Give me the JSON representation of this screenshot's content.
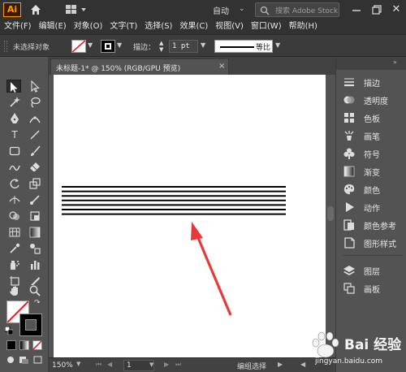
{
  "app": {
    "logo": "Ai",
    "workspace": "自动",
    "search_placeholder": "搜索 Adobe Stock"
  },
  "menu": [
    "文件(F)",
    "编辑(E)",
    "对象(O)",
    "文字(T)",
    "选择(S)",
    "效果(C)",
    "视图(V)",
    "窗口(W)",
    "帮助(H)"
  ],
  "control_bar": {
    "selection_status": "未选择对象",
    "stroke_label": "描边：",
    "stroke_weight": "1 pt",
    "profile_label": "等比"
  },
  "document": {
    "tab_title": "未标题-1* @ 150% (RGB/GPU 预览)",
    "close_glyph": "×"
  },
  "status_bar": {
    "zoom": "150%",
    "artboard_number": "1",
    "status_text": "编组选择"
  },
  "panels": [
    {
      "label": "描边",
      "icon": "stroke-lines-icon"
    },
    {
      "label": "透明度",
      "icon": "transparency-icon"
    },
    {
      "label": "色板",
      "icon": "swatches-icon"
    },
    {
      "label": "画笔",
      "icon": "brush-icon"
    },
    {
      "label": "符号",
      "icon": "club-symbol-icon"
    },
    {
      "label": "渐变",
      "icon": "gradient-icon"
    },
    {
      "label": "颜色",
      "icon": "color-palette-icon"
    },
    {
      "label": "动作",
      "icon": "play-action-icon"
    },
    {
      "label": "颜色参考",
      "icon": "color-guide-icon"
    },
    {
      "label": "图形样式",
      "icon": "graphic-style-icon"
    },
    {
      "label": "图层",
      "icon": "layers-icon"
    },
    {
      "label": "画板",
      "icon": "artboards-icon"
    }
  ],
  "artwork": {
    "horizontal_line_count": 7,
    "stroke_color": "#000000",
    "arrow_color": "#e8393a"
  },
  "colors": {
    "logo_orange": "#ff9a00",
    "ui_dark": "#323232",
    "ui_mid": "#535353",
    "artboard": "#ffffff"
  },
  "watermark": {
    "brand": "Bai 经验",
    "url": "jingyan.baidu.com"
  }
}
